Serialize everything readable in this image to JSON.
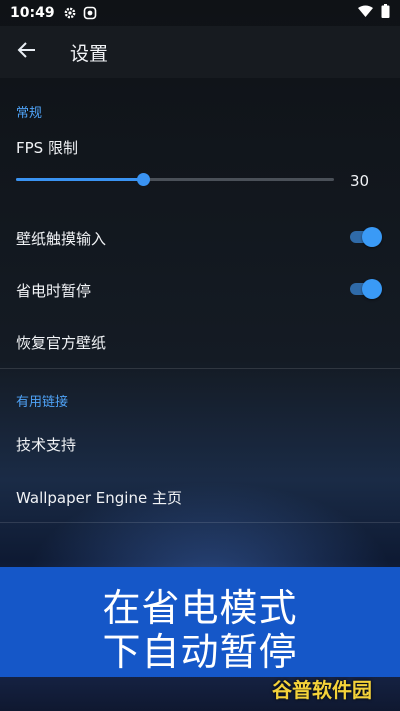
{
  "status_bar": {
    "time": "10:49",
    "icons": [
      "gear-icon",
      "screen-record-icon",
      "wifi-icon",
      "battery-icon"
    ]
  },
  "app_bar": {
    "title": "设置",
    "back_icon": "arrow-left-icon"
  },
  "general": {
    "header": "常规",
    "fps": {
      "label": "FPS 限制",
      "value": "30",
      "fraction": 0.4
    },
    "touch_input": {
      "label": "壁纸触摸输入",
      "enabled": true
    },
    "pause_on_battery_saver": {
      "label": "省电时暂停",
      "enabled": true
    },
    "restore": {
      "label": "恢复官方壁纸"
    }
  },
  "links": {
    "header": "有用链接",
    "support": {
      "label": "技术支持"
    },
    "homepage": {
      "label": "Wallpaper Engine 主页"
    }
  },
  "banner": {
    "line1": "在省电模式",
    "line2": "下自动暂停"
  },
  "watermark": {
    "text": "谷普软件园"
  },
  "colors": {
    "accent": "#3a93f2",
    "banner": "#1557c8",
    "app_bar": "#171b20"
  }
}
